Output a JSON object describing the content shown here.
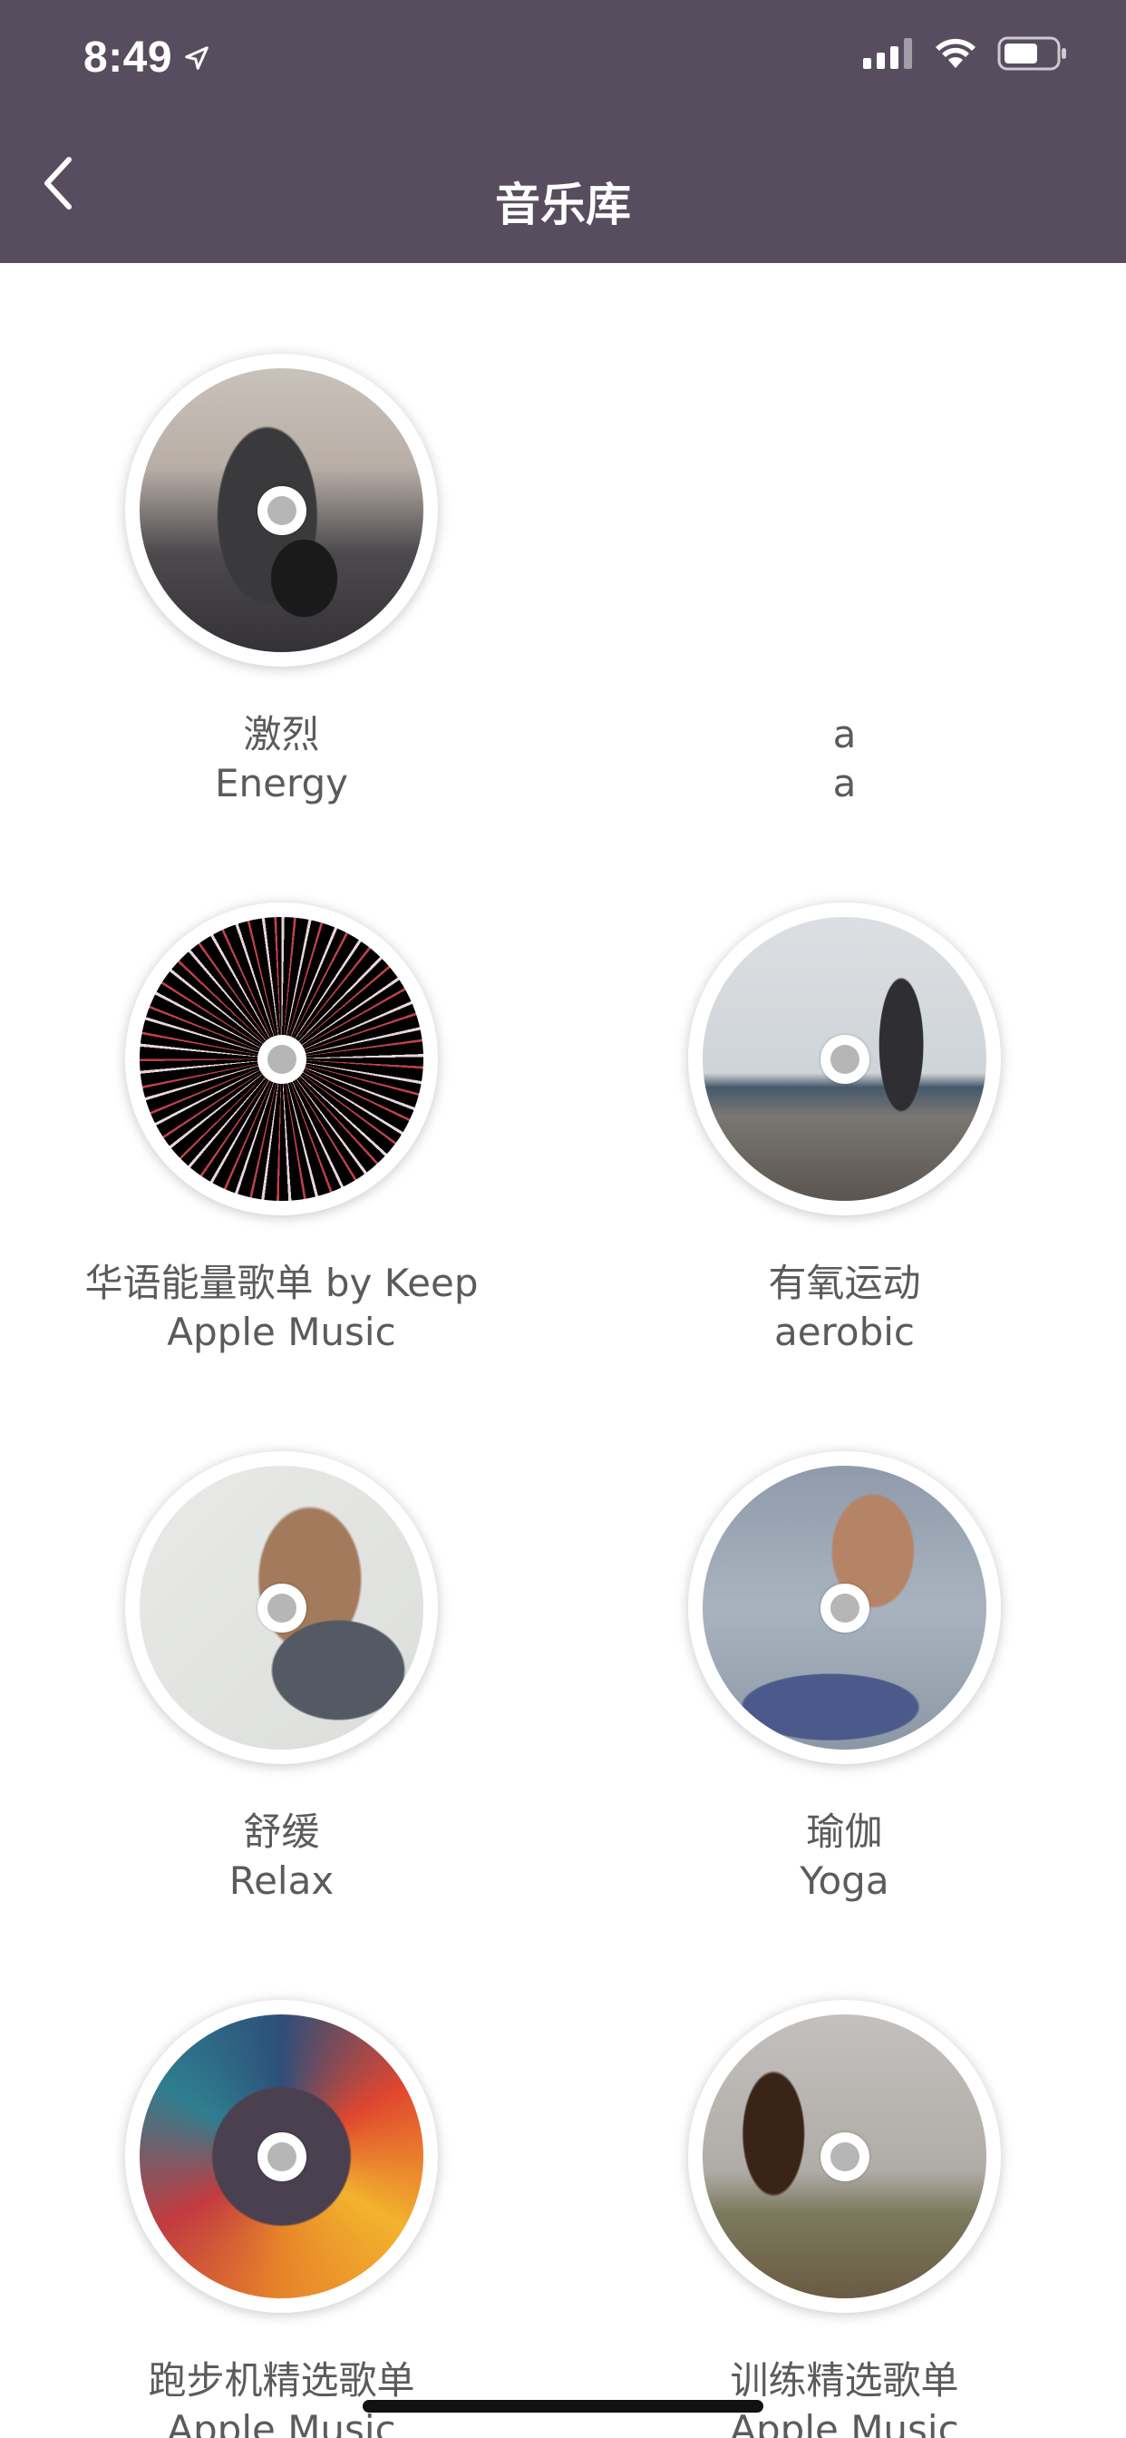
{
  "status_bar": {
    "time": "8:49"
  },
  "nav": {
    "title": "音乐库"
  },
  "items": [
    {
      "title": "激烈",
      "subtitle": "Energy",
      "art": "art-energy",
      "has_image": true
    },
    {
      "title": "a",
      "subtitle": "a",
      "art": "",
      "has_image": false
    },
    {
      "title": "华语能量歌单 by Keep",
      "subtitle": "Apple Music",
      "art": "art-fireworks",
      "has_image": true
    },
    {
      "title": "有氧运动",
      "subtitle": "aerobic",
      "art": "art-aerobic",
      "has_image": true
    },
    {
      "title": "舒缓",
      "subtitle": "Relax",
      "art": "art-relax",
      "has_image": true
    },
    {
      "title": "瑜伽",
      "subtitle": "Yoga",
      "art": "art-yoga",
      "has_image": true
    },
    {
      "title": "跑步机精选歌单",
      "subtitle": "Apple Music",
      "art": "art-treadmill",
      "has_image": true
    },
    {
      "title": "训练精选歌单",
      "subtitle": "Apple Music",
      "art": "art-training",
      "has_image": true
    }
  ],
  "icons": {
    "back": "chevron-left-icon",
    "location": "location-arrow-icon",
    "signal": "cellular-signal-icon",
    "wifi": "wifi-icon",
    "battery": "battery-icon"
  },
  "colors": {
    "header_bg": "#574d5f",
    "label_text": "#5b5b5b"
  }
}
